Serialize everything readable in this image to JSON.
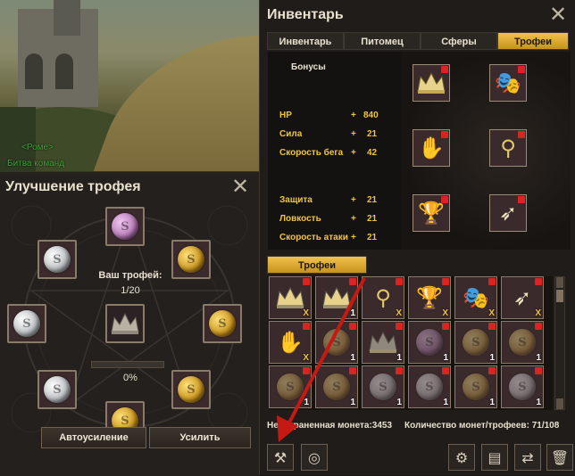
{
  "scene": {
    "chat_lines": [
      "<Роме>",
      "Битва команд"
    ]
  },
  "upgrade": {
    "title": "Улучшение трофея",
    "your_trophy_label": "Ваш трофей:",
    "count": "1/20",
    "percent": "0%",
    "progress": 0,
    "auto_button": "Автоусиление",
    "upgrade_button": "Усилить"
  },
  "inventory": {
    "title": "Инвентарь",
    "tabs": [
      "Инвентарь",
      "Питомец",
      "Сферы",
      "Трофеи"
    ],
    "active_tab": "Трофеи",
    "bonus_header": "Бонусы",
    "bonuses": [
      {
        "name": "HP",
        "op": "+",
        "value": "840"
      },
      {
        "name": "Сила",
        "op": "+",
        "value": "21"
      },
      {
        "name": "Скорость бега",
        "op": "+",
        "value": "42"
      },
      {
        "name": "Защита",
        "op": "+",
        "value": "21"
      },
      {
        "name": "Ловкость",
        "op": "+",
        "value": "21"
      },
      {
        "name": "Скорость атаки",
        "op": "+",
        "value": "21"
      }
    ],
    "trophy_subtab": "Трофеи",
    "unsold_coins_label": "Несохраненная монета:3453",
    "coins_trophies_label": "Количество монет/трофеев: 71/108",
    "accent": "#f0c53a"
  },
  "icons": [
    "close-icon",
    "crown-icon",
    "mask-icon",
    "glove-icon",
    "ring-icon",
    "goblet-icon",
    "horn-icon",
    "coin-icon",
    "lock-icon",
    "hammer-icon",
    "coins-icon",
    "gear-icon",
    "book-icon",
    "swap-icon",
    "trash-icon"
  ]
}
